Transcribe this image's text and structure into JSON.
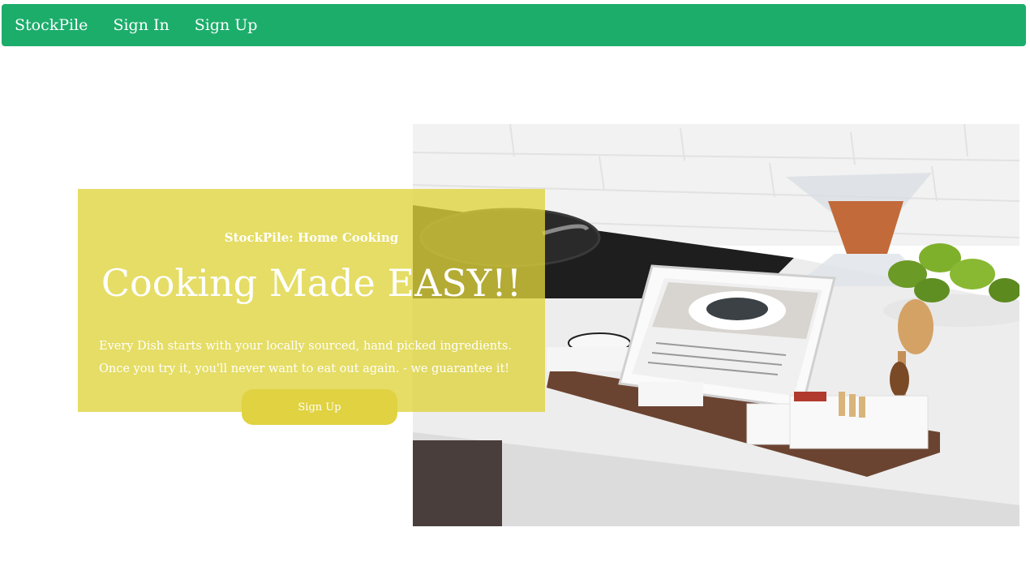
{
  "nav": {
    "brand": "StockPile",
    "links": [
      {
        "label": "Sign In"
      },
      {
        "label": "Sign Up"
      }
    ]
  },
  "hero": {
    "eyebrow": "StockPile: Home Cooking",
    "headline": "Cooking Made EASY!!",
    "tagline_lines": [
      "Every Dish starts with your locally sourced, hand picked ingredients.",
      "Once you try it, you'll never want to eat out again. - we guarantee it!"
    ],
    "cta_label": "Sign Up",
    "image_icon": "kitchen-counter-tablet-photo"
  },
  "colors": {
    "navbar": "#1cad6b",
    "card": "#ded43a",
    "button": "#e0d241",
    "text": "#ffffff"
  }
}
